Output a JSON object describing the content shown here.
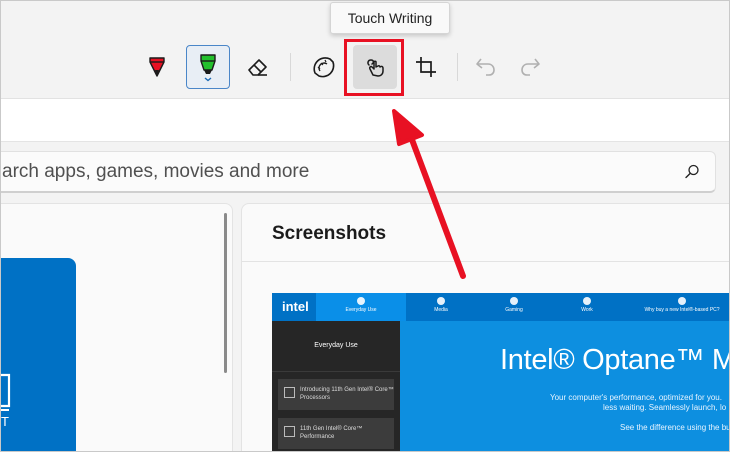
{
  "tooltip": {
    "text": "Touch Writing"
  },
  "toolbar": {
    "tools": [
      {
        "name": "ballpoint-pen",
        "icon": "pen-icon",
        "color": "#e81123"
      },
      {
        "name": "highlighter",
        "icon": "highlighter-icon",
        "color": "#22c02d",
        "selected": true
      },
      {
        "name": "eraser",
        "icon": "eraser-icon"
      },
      {
        "name": "ruler",
        "icon": "protractor-icon"
      },
      {
        "name": "touch-writing",
        "icon": "touch-writing-icon",
        "active": true
      },
      {
        "name": "crop",
        "icon": "crop-icon"
      },
      {
        "name": "undo",
        "icon": "undo-icon",
        "disabled": true
      },
      {
        "name": "redo",
        "icon": "redo-icon",
        "disabled": true
      }
    ]
  },
  "annotation": {
    "box_color": "#e81123",
    "arrow_color": "#e81123"
  },
  "search": {
    "text": "arch apps, games, movies and more",
    "icon": "search-icon"
  },
  "screenshots": {
    "title": "Screenshots",
    "thumbnail": {
      "logo": "intel",
      "tabs": [
        "Everyday Use",
        "Media",
        "Gaming",
        "Work",
        "Why buy a new Intel®-based PC?"
      ],
      "side_heading": "Everyday Use",
      "side_cards": [
        "Introducing 11th Gen Intel® Core™ Processors",
        "11th Gen Intel® Core™ Performance"
      ],
      "headline": "Intel® Optane™ Mem",
      "lines": [
        "Your computer's performance, optimized for you.",
        "less waiting. Seamlessly launch, lo",
        "See the difference using the bu"
      ]
    }
  },
  "left_tile": {
    "letter": "T"
  },
  "colors": {
    "accent_blue": "#0071c5",
    "toolbar_bg": "#f3f3f3"
  }
}
